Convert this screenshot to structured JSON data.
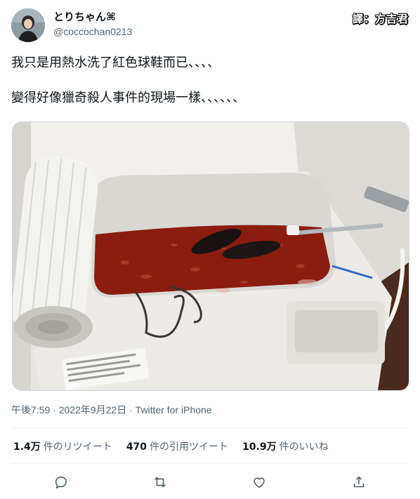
{
  "author": {
    "display_name": "とりちゃん⌘",
    "handle": "@coccochan0213"
  },
  "translator_credit": "譯：方吉君",
  "tweet": {
    "lines": [
      "我只是用熱水洗了紅色球鞋而已、、、、",
      "變得好像獵奇殺人事件的現場一樣、、、、、、"
    ]
  },
  "meta": {
    "time": "午後7:59",
    "separator1": " · ",
    "date": "2022年9月22日",
    "separator2": " · ",
    "source": "Twitter for iPhone"
  },
  "stats": [
    {
      "count": "1.4万",
      "label": "件のリツイート"
    },
    {
      "count": "470",
      "label": "件の引用ツイート"
    },
    {
      "count": "10.9万",
      "label": "件のいいね"
    }
  ],
  "actions": {
    "reply_icon": "reply-icon",
    "retweet_icon": "retweet-icon",
    "like_icon": "heart-icon",
    "share_icon": "share-icon"
  },
  "colors": {
    "text_primary": "#0f1419",
    "text_secondary": "#536471",
    "divider": "#eff3f4",
    "bath_water": "#8a1c10"
  }
}
